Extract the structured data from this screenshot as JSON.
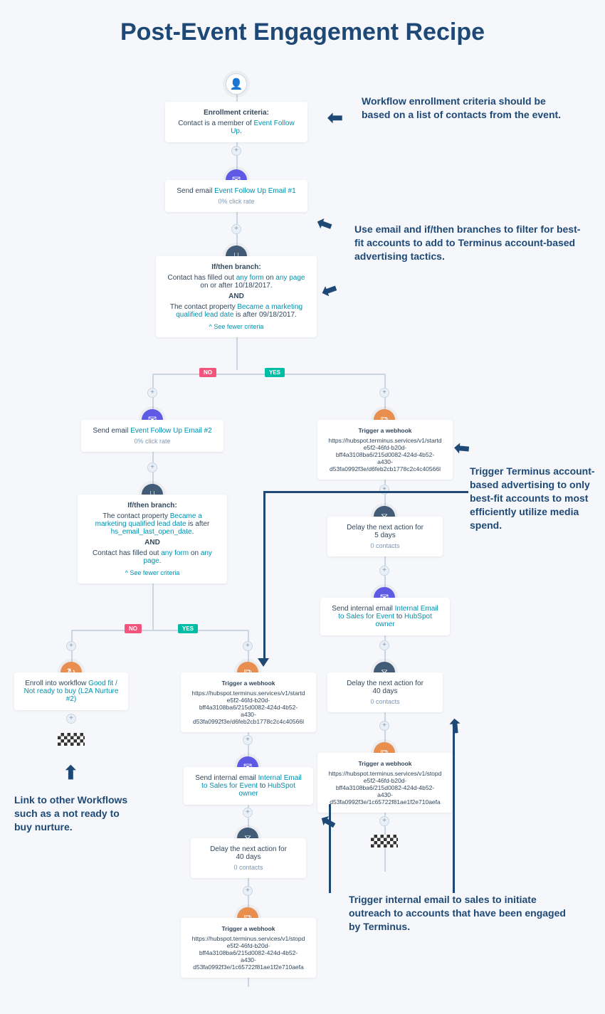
{
  "title": "Post-Event Engagement Recipe",
  "enroll": {
    "hdr": "Enrollment criteria:",
    "t1": "Contact is a member of ",
    "lnk": "Event Follow Up",
    "dot": "."
  },
  "email1": {
    "pre": "Send email ",
    "lnk": "Event Follow Up Email #1",
    "rate": "0% click rate"
  },
  "branch1": {
    "hdr": "If/then branch:",
    "l1a": "Contact has filled out ",
    "l1b": "any form",
    " l1c": " on ",
    "l1d": "any page",
    "l1e": " on or after 10/18/2017.",
    "and": "AND",
    "l2a": "The contact property ",
    "l2b": "Became a marketing qualified lead date",
    "l2c": " is after 09/18/2017.",
    "see": "^ See fewer criteria"
  },
  "no": "NO",
  "yes": "YES",
  "email2": {
    "pre": "Send email ",
    "lnk": "Event Follow Up Email #2",
    "rate": "0% click rate"
  },
  "branch2": {
    "hdr": "If/then branch:",
    "l1a": "The contact property ",
    "l1b": "Became a marketing qualified lead date",
    "l1c": " is after ",
    "l1d": "hs_email_last_open_date",
    "and": "AND",
    "l2a": "Contact has filled out ",
    "l2b": "any form",
    "l2c": " on ",
    "l2d": "any page",
    "dot": ".",
    "see": "^ See fewer criteria"
  },
  "enrollwf": {
    "pre": "Enroll into workflow ",
    "lnk": "Good fit / Not ready to buy (L2A Nurture #2)"
  },
  "wh_start": {
    "hdr": "Trigger a webhook",
    "l1": "https://hubspot.terminus.services/v1/startd",
    "l2": "e5f2-46fd-b20d-",
    "l3": "bff4a3108ba6/215d0082-424d-4b52-",
    "l4": "a430-",
    "l5": "d53fa0992f3e/d6feb2cb1778c2c4c40566l"
  },
  "wh_stop": {
    "hdr": "Trigger a webhook",
    "l1": "https://hubspot.terminus.services/v1/stopd",
    "l2": "e5f2-46fd-b20d-",
    "l3": "bff4a3108ba6/215d0082-424d-4b52-",
    "l4": "a430-",
    "l5": "d53fa0992f3e/1c65722f81ae1f2e710aefa"
  },
  "delay5": {
    "l1": "Delay the next action for",
    "l2": "5 days",
    "c": "0 contacts"
  },
  "delay40": {
    "l1": "Delay the next action for",
    "l2": "40 days",
    "c": "0 contacts"
  },
  "intemail": {
    "pre": "Send internal email ",
    "lnk": "Internal Email to Sales for Event",
    "mid": " to ",
    "own": "HubSpot owner"
  },
  "a1": "Workflow enrollment criteria should be based on a list of contacts from the event.",
  "a2": "Use email and if/then branches to filter for best-fit accounts to add to Terminus account-based advertising tactics.",
  "a3": "Trigger Terminus account-based advertising to only best-fit accounts to most efficiently utilize media spend.",
  "a4": "Link to other Workflows such as a not ready to buy nurture.",
  "a5": "Trigger internal email to sales to initiate outreach to accounts that have been engaged by Terminus."
}
